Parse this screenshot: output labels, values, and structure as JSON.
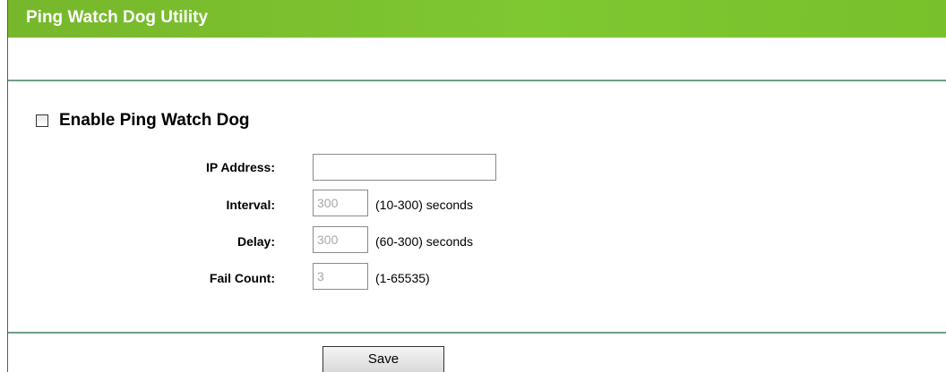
{
  "header": {
    "title": "Ping Watch Dog Utility"
  },
  "enable": {
    "label": "Enable Ping Watch Dog",
    "checked": false
  },
  "form": {
    "ip_address": {
      "label": "IP Address:",
      "value": ""
    },
    "interval": {
      "label": "Interval:",
      "value": "300",
      "hint": "(10-300) seconds"
    },
    "delay": {
      "label": "Delay:",
      "value": "300",
      "hint": "(60-300) seconds"
    },
    "fail_count": {
      "label": "Fail Count:",
      "value": "3",
      "hint": "(1-65535)"
    }
  },
  "actions": {
    "save_label": "Save"
  },
  "colors": {
    "title_bar": "#7fc832",
    "rule": "#6f9f82"
  }
}
